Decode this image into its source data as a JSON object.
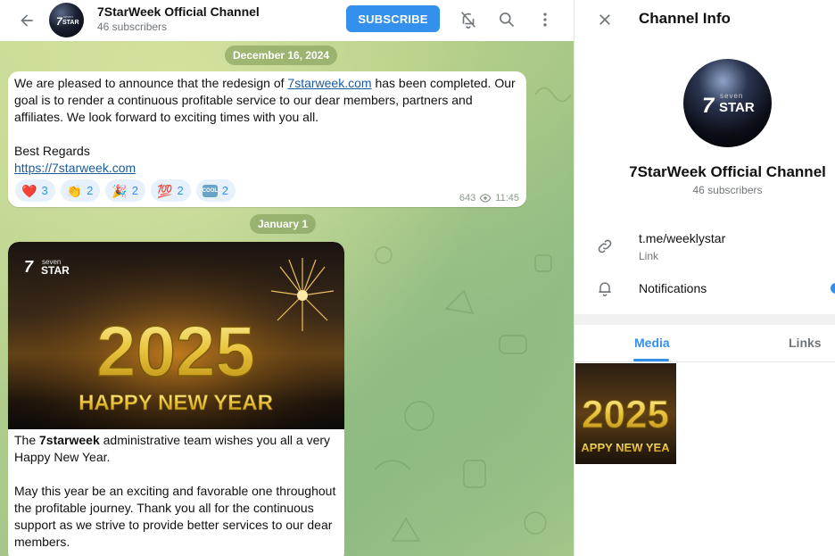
{
  "header": {
    "channel_title": "7StarWeek Official Channel",
    "subscribers": "46 subscribers",
    "subscribe_label": "SUBSCRIBE",
    "icons": [
      "back-arrow-icon",
      "mute-bell-icon",
      "search-icon",
      "more-vert-icon"
    ]
  },
  "avatar": {
    "logo_small": "seven",
    "logo_big": "STAR",
    "logo_mark": "7"
  },
  "messages": [
    {
      "date": "December 16, 2024",
      "text_pre": "We are pleased to announce that the redesign of ",
      "link_inline": "7starweek.com",
      "text_post": " has been completed. Our goal is to render a continuous profitable service to our dear members, partners and affiliates. We look forward to exciting times with you all.",
      "signoff": "Best Regards",
      "link_url": "https://7starweek.com",
      "reactions": [
        {
          "emoji": "❤️",
          "count": "3"
        },
        {
          "emoji": "👏",
          "count": "2"
        },
        {
          "emoji": "🎉",
          "count": "2"
        },
        {
          "emoji": "💯",
          "count": "2"
        },
        {
          "emoji": "COOL",
          "count": "2"
        }
      ],
      "views": "643",
      "time": "11:45"
    },
    {
      "date": "January 1",
      "image": {
        "brand_small": "seven",
        "brand_big": "STAR",
        "year": "2025",
        "greeting": "HAPPY NEW YEAR"
      },
      "para1_pre": "The ",
      "para1_bold": "7starweek",
      "para1_post": " administrative team wishes you all a very Happy New Year.",
      "para2": "May this year be an exciting and favorable one throughout the profitable journey. Thank you all for the continuous support as we strive to provide better services to our dear members."
    }
  ],
  "info_panel": {
    "title": "Channel Info",
    "name": "7StarWeek Official Channel",
    "subscribers": "46 subscribers",
    "link_value": "t.me/weeklystar",
    "link_label": "Link",
    "notifications_label": "Notifications",
    "tabs": [
      "Media",
      "Links"
    ],
    "active_tab": "Media",
    "thumb_year": "2025",
    "thumb_text": "APPY NEW YEA"
  },
  "colors": {
    "accent": "#3390ec",
    "link": "#1a5a9e",
    "gold": "#e8c23a"
  }
}
